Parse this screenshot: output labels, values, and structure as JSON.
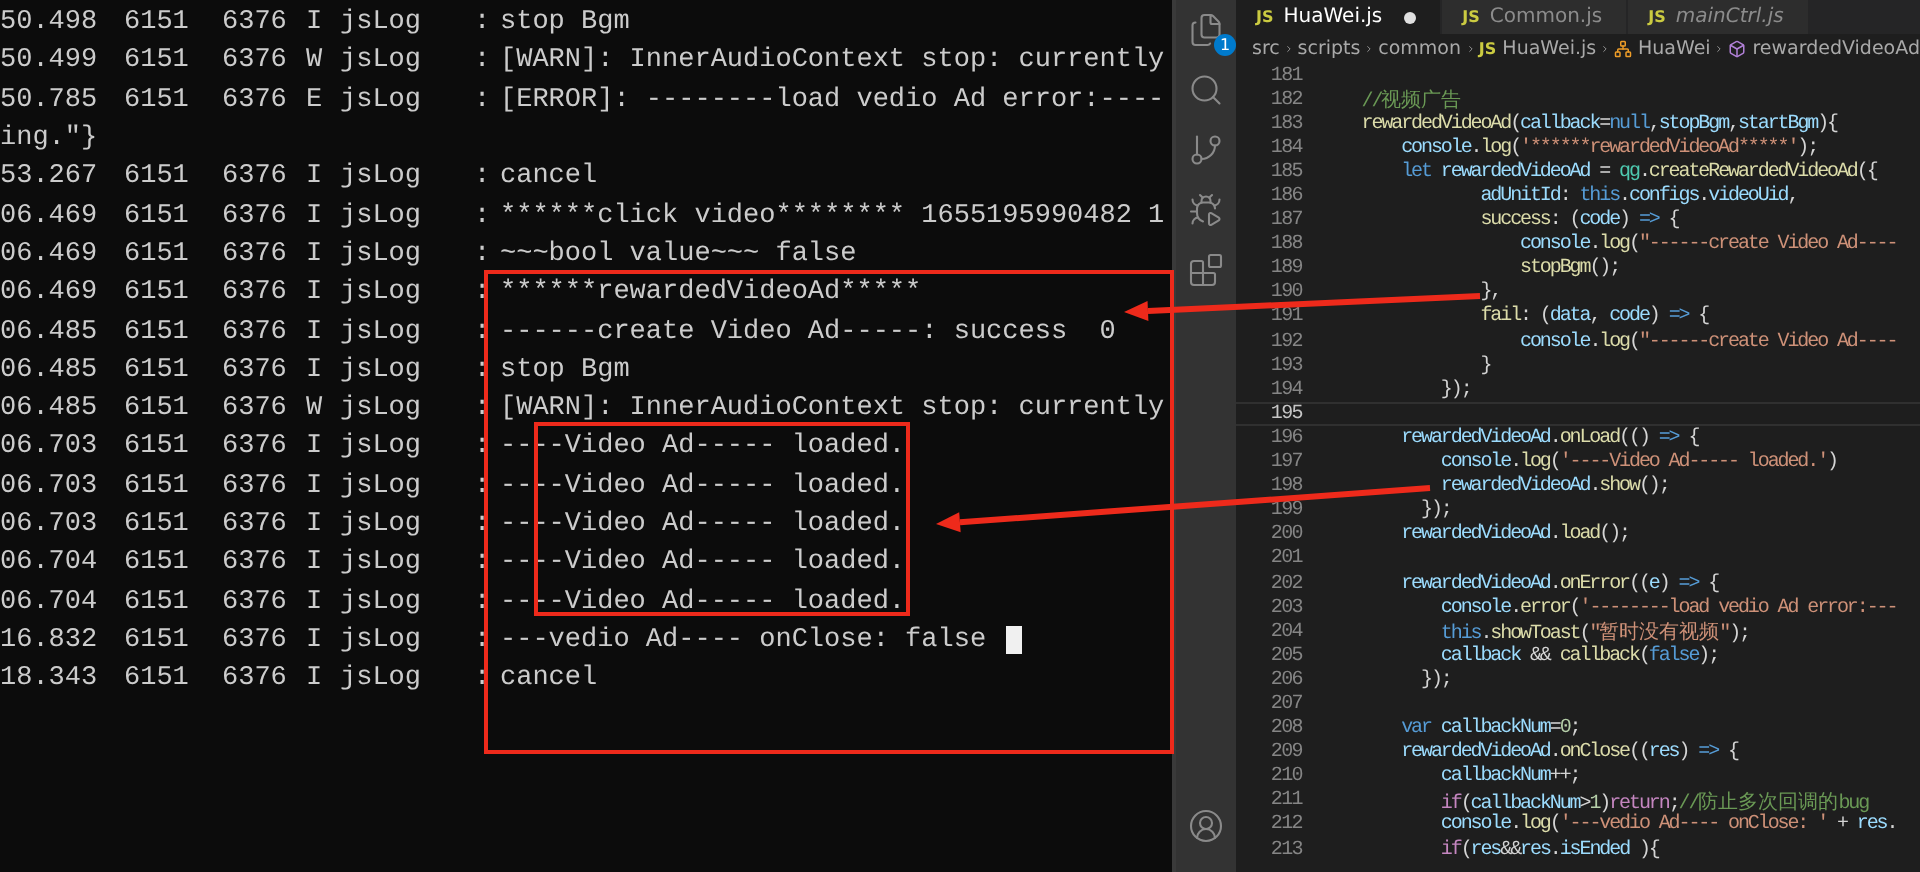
{
  "terminal": {
    "rows": [
      {
        "kind": "log",
        "time": "50.498",
        "pid": "6151",
        "tid": "6376",
        "level": "I",
        "tag": "jsLog",
        "colon": ":",
        "message": "stop Bgm",
        "cursor": false
      },
      {
        "kind": "log",
        "time": "50.499",
        "pid": "6151",
        "tid": "6376",
        "level": "W",
        "tag": "jsLog",
        "colon": ":",
        "message": "[WARN]: InnerAudioContext stop: currently",
        "cursor": false
      },
      {
        "kind": "log",
        "time": "50.785",
        "pid": "6151",
        "tid": "6376",
        "level": "E",
        "tag": "jsLog",
        "colon": ":",
        "message": "[ERROR]: --------load vedio Ad error:----",
        "cursor": false
      },
      {
        "kind": "continuation",
        "message": "ing.\"}",
        "cursor": false
      },
      {
        "kind": "log",
        "time": "53.267",
        "pid": "6151",
        "tid": "6376",
        "level": "I",
        "tag": "jsLog",
        "colon": ":",
        "message": "cancel",
        "cursor": false
      },
      {
        "kind": "log",
        "time": "06.469",
        "pid": "6151",
        "tid": "6376",
        "level": "I",
        "tag": "jsLog",
        "colon": ":",
        "message": "******click video******** 1655195990482 1",
        "cursor": false
      },
      {
        "kind": "log",
        "time": "06.469",
        "pid": "6151",
        "tid": "6376",
        "level": "I",
        "tag": "jsLog",
        "colon": ":",
        "message": "~~~bool value~~~ false",
        "cursor": false
      },
      {
        "kind": "log",
        "time": "06.469",
        "pid": "6151",
        "tid": "6376",
        "level": "I",
        "tag": "jsLog",
        "colon": ":",
        "message": "******rewardedVideoAd*****",
        "cursor": false
      },
      {
        "kind": "log",
        "time": "06.485",
        "pid": "6151",
        "tid": "6376",
        "level": "I",
        "tag": "jsLog",
        "colon": ":",
        "message": "------create Video Ad-----: success  0",
        "cursor": false
      },
      {
        "kind": "log",
        "time": "06.485",
        "pid": "6151",
        "tid": "6376",
        "level": "I",
        "tag": "jsLog",
        "colon": ":",
        "message": "stop Bgm",
        "cursor": false
      },
      {
        "kind": "log",
        "time": "06.485",
        "pid": "6151",
        "tid": "6376",
        "level": "W",
        "tag": "jsLog",
        "colon": ":",
        "message": "[WARN]: InnerAudioContext stop: currently",
        "cursor": false
      },
      {
        "kind": "log",
        "time": "06.703",
        "pid": "6151",
        "tid": "6376",
        "level": "I",
        "tag": "jsLog",
        "colon": ":",
        "message": "----Video Ad----- loaded.",
        "cursor": false
      },
      {
        "kind": "log",
        "time": "06.703",
        "pid": "6151",
        "tid": "6376",
        "level": "I",
        "tag": "jsLog",
        "colon": ":",
        "message": "----Video Ad----- loaded.",
        "cursor": false
      },
      {
        "kind": "log",
        "time": "06.703",
        "pid": "6151",
        "tid": "6376",
        "level": "I",
        "tag": "jsLog",
        "colon": ":",
        "message": "----Video Ad----- loaded.",
        "cursor": false
      },
      {
        "kind": "log",
        "time": "06.704",
        "pid": "6151",
        "tid": "6376",
        "level": "I",
        "tag": "jsLog",
        "colon": ":",
        "message": "----Video Ad----- loaded.",
        "cursor": false
      },
      {
        "kind": "log",
        "time": "06.704",
        "pid": "6151",
        "tid": "6376",
        "level": "I",
        "tag": "jsLog",
        "colon": ":",
        "message": "----Video Ad----- loaded.",
        "cursor": false
      },
      {
        "kind": "log",
        "time": "16.832",
        "pid": "6151",
        "tid": "6376",
        "level": "I",
        "tag": "jsLog",
        "colon": ":",
        "message": "---vedio Ad---- onClose: false",
        "cursor": true
      },
      {
        "kind": "log",
        "time": "18.343",
        "pid": "6151",
        "tid": "6376",
        "level": "I",
        "tag": "jsLog",
        "colon": ":",
        "message": "cancel",
        "cursor": false
      }
    ]
  },
  "activity_bar": {
    "items": [
      {
        "kind": "files",
        "badge": "1"
      },
      {
        "kind": "search"
      },
      {
        "kind": "source-control"
      },
      {
        "kind": "run"
      },
      {
        "kind": "extensions"
      }
    ],
    "account": {
      "kind": "account"
    }
  },
  "editor": {
    "tabs": [
      {
        "icon_text": "JS",
        "label": "HuaWei.js",
        "selected": true,
        "modified": true,
        "preview": false
      },
      {
        "icon_text": "JS",
        "label": "Common.js",
        "selected": false,
        "modified": false,
        "preview": false
      },
      {
        "icon_text": "JS",
        "label": "mainCtrl.js",
        "selected": false,
        "modified": false,
        "preview": true
      }
    ],
    "breadcrumbs": [
      {
        "kind": "folder",
        "text": "src"
      },
      {
        "kind": "folder",
        "text": "scripts"
      },
      {
        "kind": "folder",
        "text": "common"
      },
      {
        "kind": "file",
        "icon_text": "JS",
        "text": "HuaWei.js"
      },
      {
        "kind": "class",
        "text": "HuaWei"
      },
      {
        "kind": "method",
        "text": "rewardedVideoAd"
      }
    ],
    "lines": [
      {
        "number": "181",
        "active": false
      },
      {
        "number": "182",
        "active": false,
        "tokens": [
          {
            "kind": "comment",
            "text": "    //视频广告"
          }
        ]
      },
      {
        "number": "183",
        "active": false,
        "tokens": [
          {
            "kind": "function",
            "text": "    rewardedVideoAd"
          },
          {
            "kind": "plain",
            "text": "("
          },
          {
            "kind": "variable",
            "text": "callback"
          },
          {
            "kind": "plain",
            "text": "="
          },
          {
            "kind": "keyword",
            "text": "null"
          },
          {
            "kind": "plain",
            "text": ","
          },
          {
            "kind": "variable",
            "text": "stopBgm"
          },
          {
            "kind": "plain",
            "text": ","
          },
          {
            "kind": "variable",
            "text": "startBgm"
          },
          {
            "kind": "plain",
            "text": "){"
          }
        ]
      },
      {
        "number": "184",
        "active": false,
        "tokens": [
          {
            "kind": "variable",
            "text": "        console"
          },
          {
            "kind": "plain",
            "text": "."
          },
          {
            "kind": "function",
            "text": "log"
          },
          {
            "kind": "plain",
            "text": "("
          },
          {
            "kind": "string",
            "text": "'******rewardedVideoAd*****'"
          },
          {
            "kind": "plain",
            "text": ");"
          }
        ]
      },
      {
        "number": "185",
        "active": false,
        "tokens": [
          {
            "kind": "keyword",
            "text": "        let "
          },
          {
            "kind": "variable",
            "text": "rewardedVideoAd"
          },
          {
            "kind": "plain",
            "text": " = "
          },
          {
            "kind": "type",
            "text": "qg"
          },
          {
            "kind": "plain",
            "text": "."
          },
          {
            "kind": "function",
            "text": "createRewardedVideoAd"
          },
          {
            "kind": "plain",
            "text": "({"
          }
        ]
      },
      {
        "number": "186",
        "active": false,
        "tokens": [
          {
            "kind": "variable",
            "text": "                adUnitId"
          },
          {
            "kind": "plain",
            "text": ": "
          },
          {
            "kind": "keyword",
            "text": "this"
          },
          {
            "kind": "plain",
            "text": "."
          },
          {
            "kind": "variable",
            "text": "configs"
          },
          {
            "kind": "plain",
            "text": "."
          },
          {
            "kind": "variable",
            "text": "videoUid"
          },
          {
            "kind": "plain",
            "text": ","
          }
        ]
      },
      {
        "number": "187",
        "active": false,
        "tokens": [
          {
            "kind": "function",
            "text": "                success"
          },
          {
            "kind": "plain",
            "text": ": ("
          },
          {
            "kind": "variable",
            "text": "code"
          },
          {
            "kind": "plain",
            "text": ") "
          },
          {
            "kind": "keyword",
            "text": "=>"
          },
          {
            "kind": "plain",
            "text": " {"
          }
        ]
      },
      {
        "number": "188",
        "active": false,
        "tokens": [
          {
            "kind": "variable",
            "text": "                    console"
          },
          {
            "kind": "plain",
            "text": "."
          },
          {
            "kind": "function",
            "text": "log"
          },
          {
            "kind": "plain",
            "text": "("
          },
          {
            "kind": "string",
            "text": "\"------create Video Ad----"
          }
        ]
      },
      {
        "number": "189",
        "active": false,
        "tokens": [
          {
            "kind": "function",
            "text": "                    stopBgm"
          },
          {
            "kind": "plain",
            "text": "();"
          }
        ]
      },
      {
        "number": "190",
        "active": false,
        "tokens": [
          {
            "kind": "plain",
            "text": "                },"
          }
        ]
      },
      {
        "number": "191",
        "active": false,
        "tokens": [
          {
            "kind": "function",
            "text": "                fail"
          },
          {
            "kind": "plain",
            "text": ": ("
          },
          {
            "kind": "variable",
            "text": "data"
          },
          {
            "kind": "plain",
            "text": ", "
          },
          {
            "kind": "variable",
            "text": "code"
          },
          {
            "kind": "plain",
            "text": ") "
          },
          {
            "kind": "keyword",
            "text": "=>"
          },
          {
            "kind": "plain",
            "text": " {"
          }
        ]
      },
      {
        "number": "192",
        "active": false,
        "tokens": [
          {
            "kind": "variable",
            "text": "                    console"
          },
          {
            "kind": "plain",
            "text": "."
          },
          {
            "kind": "function",
            "text": "log"
          },
          {
            "kind": "plain",
            "text": "("
          },
          {
            "kind": "string",
            "text": "\"------create Video Ad----"
          }
        ]
      },
      {
        "number": "193",
        "active": false,
        "tokens": [
          {
            "kind": "plain",
            "text": "                }"
          }
        ]
      },
      {
        "number": "194",
        "active": false,
        "tokens": [
          {
            "kind": "plain",
            "text": "            });"
          }
        ]
      },
      {
        "number": "195",
        "active": true
      },
      {
        "number": "196",
        "active": false,
        "tokens": [
          {
            "kind": "variable",
            "text": "        rewardedVideoAd"
          },
          {
            "kind": "plain",
            "text": "."
          },
          {
            "kind": "function",
            "text": "onLoad"
          },
          {
            "kind": "plain",
            "text": "(() "
          },
          {
            "kind": "keyword",
            "text": "=>"
          },
          {
            "kind": "plain",
            "text": " {"
          }
        ]
      },
      {
        "number": "197",
        "active": false,
        "tokens": [
          {
            "kind": "variable",
            "text": "            console"
          },
          {
            "kind": "plain",
            "text": "."
          },
          {
            "kind": "function",
            "text": "log"
          },
          {
            "kind": "plain",
            "text": "("
          },
          {
            "kind": "string",
            "text": "'----Video Ad----- loaded.'"
          },
          {
            "kind": "plain",
            "text": ")"
          }
        ]
      },
      {
        "number": "198",
        "active": false,
        "tokens": [
          {
            "kind": "variable",
            "text": "            rewardedVideoAd"
          },
          {
            "kind": "plain",
            "text": "."
          },
          {
            "kind": "function",
            "text": "show"
          },
          {
            "kind": "plain",
            "text": "();"
          }
        ]
      },
      {
        "number": "199",
        "active": false,
        "tokens": [
          {
            "kind": "plain",
            "text": "          });"
          }
        ]
      },
      {
        "number": "200",
        "active": false,
        "tokens": [
          {
            "kind": "variable",
            "text": "        rewardedVideoAd"
          },
          {
            "kind": "plain",
            "text": "."
          },
          {
            "kind": "function",
            "text": "load"
          },
          {
            "kind": "plain",
            "text": "();"
          }
        ]
      },
      {
        "number": "201",
        "active": false
      },
      {
        "number": "202",
        "active": false,
        "tokens": [
          {
            "kind": "variable",
            "text": "        rewardedVideoAd"
          },
          {
            "kind": "plain",
            "text": "."
          },
          {
            "kind": "function",
            "text": "onError"
          },
          {
            "kind": "plain",
            "text": "(("
          },
          {
            "kind": "variable",
            "text": "e"
          },
          {
            "kind": "plain",
            "text": ") "
          },
          {
            "kind": "keyword",
            "text": "=>"
          },
          {
            "kind": "plain",
            "text": " {"
          }
        ]
      },
      {
        "number": "203",
        "active": false,
        "tokens": [
          {
            "kind": "variable",
            "text": "            console"
          },
          {
            "kind": "plain",
            "text": "."
          },
          {
            "kind": "function",
            "text": "error"
          },
          {
            "kind": "plain",
            "text": "("
          },
          {
            "kind": "string",
            "text": "'--------load vedio Ad error:---"
          }
        ]
      },
      {
        "number": "204",
        "active": false,
        "tokens": [
          {
            "kind": "keyword",
            "text": "            this"
          },
          {
            "kind": "plain",
            "text": "."
          },
          {
            "kind": "function",
            "text": "showToast"
          },
          {
            "kind": "plain",
            "text": "("
          },
          {
            "kind": "string",
            "text": "\"暂时没有视频\""
          },
          {
            "kind": "plain",
            "text": ");"
          }
        ]
      },
      {
        "number": "205",
        "active": false,
        "tokens": [
          {
            "kind": "variable",
            "text": "            callback"
          },
          {
            "kind": "plain",
            "text": " && "
          },
          {
            "kind": "function",
            "text": "callback"
          },
          {
            "kind": "plain",
            "text": "("
          },
          {
            "kind": "keyword",
            "text": "false"
          },
          {
            "kind": "plain",
            "text": ");"
          }
        ]
      },
      {
        "number": "206",
        "active": false,
        "tokens": [
          {
            "kind": "plain",
            "text": "          });"
          }
        ]
      },
      {
        "number": "207",
        "active": false
      },
      {
        "number": "208",
        "active": false,
        "tokens": [
          {
            "kind": "keyword",
            "text": "        var "
          },
          {
            "kind": "variable",
            "text": "callbackNum"
          },
          {
            "kind": "plain",
            "text": "="
          },
          {
            "kind": "number",
            "text": "0"
          },
          {
            "kind": "plain",
            "text": ";"
          }
        ]
      },
      {
        "number": "209",
        "active": false,
        "tokens": [
          {
            "kind": "variable",
            "text": "        rewardedVideoAd"
          },
          {
            "kind": "plain",
            "text": "."
          },
          {
            "kind": "function",
            "text": "onClose"
          },
          {
            "kind": "plain",
            "text": "(("
          },
          {
            "kind": "variable",
            "text": "res"
          },
          {
            "kind": "plain",
            "text": ") "
          },
          {
            "kind": "keyword",
            "text": "=>"
          },
          {
            "kind": "plain",
            "text": " {"
          }
        ]
      },
      {
        "number": "210",
        "active": false,
        "tokens": [
          {
            "kind": "variable",
            "text": "            callbackNum"
          },
          {
            "kind": "plain",
            "text": "++;"
          }
        ]
      },
      {
        "number": "211",
        "active": false,
        "tokens": [
          {
            "kind": "control",
            "text": "            if"
          },
          {
            "kind": "plain",
            "text": "("
          },
          {
            "kind": "variable",
            "text": "callbackNum"
          },
          {
            "kind": "plain",
            "text": ">"
          },
          {
            "kind": "number",
            "text": "1"
          },
          {
            "kind": "plain",
            "text": ")"
          },
          {
            "kind": "control",
            "text": "return"
          },
          {
            "kind": "plain",
            "text": ";"
          },
          {
            "kind": "comment",
            "text": "//防止多次回调的bug"
          }
        ]
      },
      {
        "number": "212",
        "active": false,
        "tokens": [
          {
            "kind": "variable",
            "text": "            console"
          },
          {
            "kind": "plain",
            "text": "."
          },
          {
            "kind": "function",
            "text": "log"
          },
          {
            "kind": "plain",
            "text": "("
          },
          {
            "kind": "string",
            "text": "'---vedio Ad---- onClose: '"
          },
          {
            "kind": "plain",
            "text": " + "
          },
          {
            "kind": "variable",
            "text": "res"
          },
          {
            "kind": "plain",
            "text": "."
          }
        ]
      },
      {
        "number": "213",
        "active": false,
        "tokens": [
          {
            "kind": "control",
            "text": "            if"
          },
          {
            "kind": "plain",
            "text": "("
          },
          {
            "kind": "variable",
            "text": "res"
          },
          {
            "kind": "plain",
            "text": "&&"
          },
          {
            "kind": "variable",
            "text": "res"
          },
          {
            "kind": "plain",
            "text": "."
          },
          {
            "kind": "variable",
            "text": "isEnded"
          },
          {
            "kind": "plain",
            "text": " ){"
          }
        ]
      }
    ]
  }
}
